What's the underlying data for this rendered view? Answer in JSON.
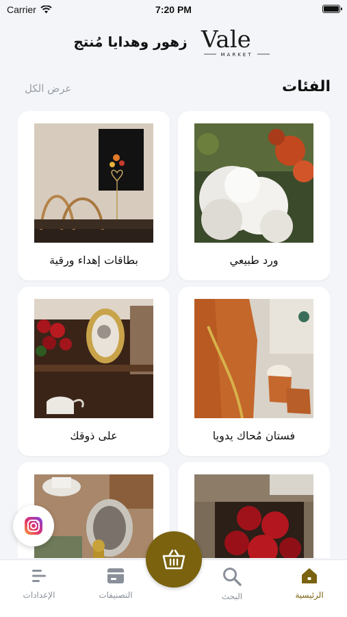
{
  "status_bar": {
    "carrier": "Carrier",
    "time": "7:20 PM"
  },
  "header": {
    "title": "زهور وهدايا مُنتج",
    "logo_text": "Vale",
    "logo_sub": "MARKET"
  },
  "section": {
    "title": "الفئات",
    "see_all": "عرض الكل"
  },
  "categories": [
    {
      "label": "ورد طبيعي",
      "image": "white-hydrangea-flowers"
    },
    {
      "label": "بطاقات إهداء ورقية",
      "image": "gift-card-and-bag"
    },
    {
      "label": "فستان مُحاك يدويا",
      "image": "knitted-dress-and-booties"
    },
    {
      "label": "على ذوقك",
      "image": "roses-and-gold-frame"
    },
    {
      "label": "",
      "image": "red-roses-box"
    },
    {
      "label": "",
      "image": "tea-set-and-frame"
    }
  ],
  "bottom_nav": {
    "home": "الرئيسية",
    "search": "البحث",
    "categories": "التصنيفات",
    "settings": "الإعدادات"
  },
  "colors": {
    "accent": "#7a620f",
    "background": "#f3f5f8",
    "muted": "#9aa0a8"
  },
  "icons": {
    "cart": "basket-icon",
    "instagram": "instagram-icon"
  }
}
